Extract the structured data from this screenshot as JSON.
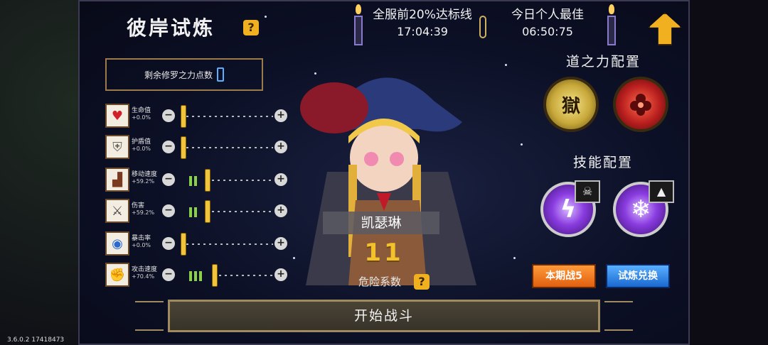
{
  "title": "彼岸试炼",
  "remaining_points_label": "剩余修罗之力点数",
  "server_threshold": {
    "label": "全服前20%达标线",
    "time": "17:04:39"
  },
  "personal_best": {
    "label": "今日个人最佳",
    "time": "06:50:75"
  },
  "dao_section_title": "道之力配置",
  "skill_section_title": "技能配置",
  "dao_orbs": [
    {
      "glyph": "獄"
    },
    {
      "glyph": ""
    }
  ],
  "stats": [
    {
      "name": "生命值",
      "pct": "+0.0%",
      "icon": "heart-icon",
      "level": 0
    },
    {
      "name": "护盾值",
      "pct": "+0.0%",
      "icon": "shield-icon",
      "level": 0
    },
    {
      "name": "移动速度",
      "pct": "+59.2%",
      "icon": "boot-icon",
      "level": 2
    },
    {
      "name": "伤害",
      "pct": "+59.2%",
      "icon": "sword-icon",
      "level": 2
    },
    {
      "name": "暴击率",
      "pct": "+0.0%",
      "icon": "eye-icon",
      "level": 0
    },
    {
      "name": "攻击速度",
      "pct": "+70.4%",
      "icon": "gauntlet-icon",
      "level": 3
    }
  ],
  "character": {
    "name": "凯瑟琳",
    "danger_value": "11",
    "danger_label": "危险系数"
  },
  "buttons": {
    "season_battle": "本期战5",
    "trial_exchange": "试炼兑换",
    "start": "开始战斗"
  },
  "version": "3.6.0.2 17418473",
  "colors": {
    "accent_gold": "#f2c43a",
    "button_orange": "#e06010",
    "button_blue": "#1a68d0"
  }
}
